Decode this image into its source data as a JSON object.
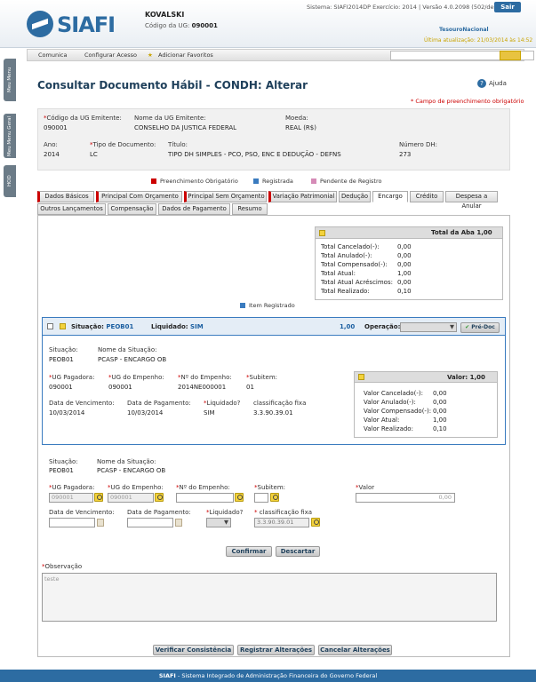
{
  "header": {
    "user": "KOVALSKI",
    "ug_label": "Código da UG:",
    "ug_code": "090001",
    "system_info": "Sistema: SIAFI2014DP Exercício: 2014 | Versão 4.0.2098 (502/desenv)",
    "sair": "Sair",
    "tesouro": "TesouroNacional",
    "ultima_atualizacao": "Última atualização: 21/03/2014 às 14:52",
    "logo_text": "SIAFI"
  },
  "menu": {
    "comunica": "Comunica",
    "configurar": "Configurar Acesso",
    "favoritos": "Adicionar Favoritos"
  },
  "sidebar": {
    "tab1": "Meu Menu",
    "tab2": "Meu Menu Geral",
    "tab3": "HOD"
  },
  "page": {
    "title": "Consultar Documento Hábil - CONDH: Alterar",
    "ajuda": "Ajuda",
    "obrigatorio": "* Campo de preenchimento obrigatório"
  },
  "doc": {
    "cod_ug_label": "Código da UG Emitente:",
    "cod_ug": "090001",
    "nome_ug_label": "Nome da UG Emitente:",
    "nome_ug": "CONSELHO DA JUSTICA FEDERAL",
    "moeda_label": "Moeda:",
    "moeda": "REAL (R$)",
    "ano_label": "Ano:",
    "ano": "2014",
    "tipo_label": "Tipo de Documento:",
    "tipo": "LC",
    "titulo_label": "Título:",
    "titulo": "TIPO DH SIMPLES - PCO, PSO, ENC E DEDUÇÃO - DEFNS",
    "numero_label": "Número DH:",
    "numero": "273"
  },
  "legend": {
    "obrigatorio": "Preenchimento Obrigatório",
    "registrada": "Registrada",
    "pendente": "Pendente de Registro",
    "item_registrado": "Item Registrado"
  },
  "tabs_row1": [
    "Dados Básicos",
    "Principal Com Orçamento",
    "Principal Sem Orçamento",
    "Variação Patrimonial",
    "Dedução",
    "Encargo",
    "Crédito",
    "Despesa a Anular"
  ],
  "tabs_row2": [
    "Outros Lançamentos",
    "Compensação",
    "Dados de Pagamento",
    "Resumo"
  ],
  "total_aba": {
    "label": "Total da Aba",
    "value": "1,00",
    "rows": [
      {
        "label": "Total Cancelado(-):",
        "value": "0,00"
      },
      {
        "label": "Total Anulado(-):",
        "value": "0,00"
      },
      {
        "label": "Total Compensado(-):",
        "value": "0,00"
      },
      {
        "label": "Total Atual:",
        "value": "1,00"
      },
      {
        "label": "Total Atual Acréscimos:",
        "value": "0,00"
      },
      {
        "label": "Total Realizado:",
        "value": "0,10"
      }
    ]
  },
  "situacao": {
    "situacao_label": "Situação:",
    "situacao": "PEOB01",
    "liquidado_label": "Liquidado:",
    "liquidado": "SIM",
    "valor": "1,00",
    "operacao_label": "Operação:",
    "pre_doc": "Pré-Doc",
    "sit_label": "Situação:",
    "sit": "PEOB01",
    "nome_sit_label": "Nome da Situação:",
    "nome_sit": "PCASP - ENCARGO OB",
    "ug_pag_label": "UG Pagadora:",
    "ug_pag": "090001",
    "ug_emp_label": "UG do Empenho:",
    "ug_emp": "090001",
    "n_emp_label": "Nº do Empenho:",
    "n_emp": "2014NE000001",
    "subitem_label": "Subitem:",
    "subitem": "01",
    "venc_label": "Data de Vencimento:",
    "venc": "10/03/2014",
    "pag_label": "Data de Pagamento:",
    "pag": "10/03/2014",
    "liq_label": "Liquidado?",
    "liq": "SIM",
    "class_label": "classificação fixa",
    "class": "3.3.90.39.01"
  },
  "valor_box": {
    "label": "Valor:",
    "value": "1,00",
    "rows": [
      {
        "label": "Valor Cancelado(-):",
        "value": "0,00"
      },
      {
        "label": "Valor Anulado(-):",
        "value": "0,00"
      },
      {
        "label": "Valor Compensado(-):",
        "value": "0,00"
      },
      {
        "label": "Valor Atual:",
        "value": "1,00"
      },
      {
        "label": "Valor Realizado:",
        "value": "0,10"
      }
    ]
  },
  "form": {
    "sit_label": "Situação:",
    "sit": "PEOB01",
    "nome_sit_label": "Nome da Situação:",
    "nome_sit": "PCASP - ENCARGO OB",
    "ug_pag_label": "UG Pagadora:",
    "ug_pag": "090001",
    "ug_emp_label": "UG do Empenho:",
    "ug_emp": "090001",
    "n_emp_label": "Nº do Empenho:",
    "subitem_label": "Subitem:",
    "valor_label": "Valor",
    "valor": "0,00",
    "venc_label": "Data de Vencimento:",
    "pag_label": "Data de Pagamento:",
    "liq_label": "Liquidado?",
    "class_label": "classificação fixa",
    "class": "3.3.90.39.01",
    "confirmar": "Confirmar",
    "descartar": "Descartar",
    "obs_label": "Observação",
    "obs": "teste"
  },
  "actions": {
    "verificar": "Verificar Consistência",
    "registrar": "Registrar Alterações",
    "cancelar": "Cancelar Alterações"
  },
  "footer": {
    "bold": "SIAFI",
    "text": " - Sistema Integrado de Administração Financeira do Governo Federal"
  }
}
